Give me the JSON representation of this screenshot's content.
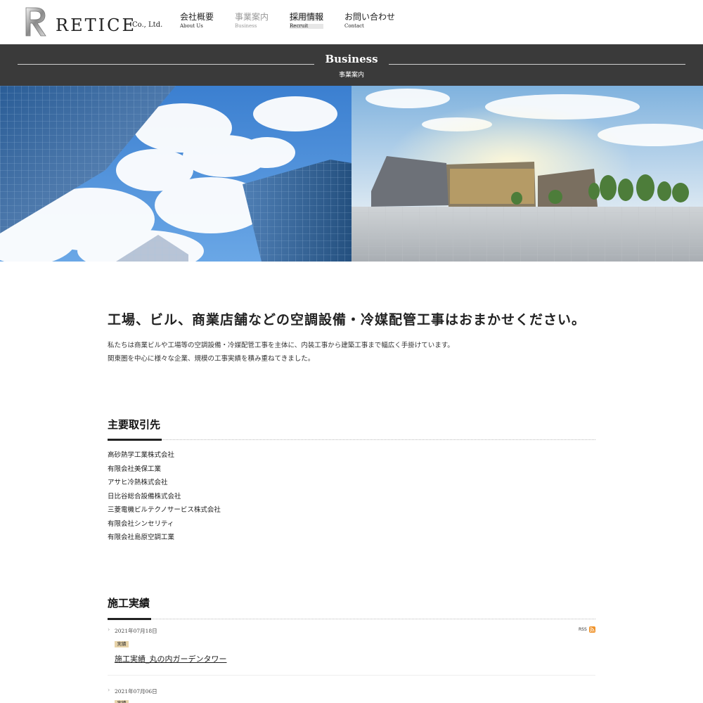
{
  "header": {
    "logo_text": "RETICE",
    "logo_sub": "Co., Ltd.",
    "nav": [
      {
        "jp": "会社概要",
        "en": "About Us"
      },
      {
        "jp": "事業案内",
        "en": "Business"
      },
      {
        "jp": "採用情報",
        "en": "Recruit"
      },
      {
        "jp": "お問い合わせ",
        "en": "Contact"
      }
    ]
  },
  "banner": {
    "title": "Business",
    "subtitle": "事業案内"
  },
  "intro": {
    "lead": "工場、ビル、商業店舗などの空調設備・冷媒配管工事はおまかせください。",
    "line1": "私たちは商業ビルや工場等の空調設備・冷媒配管工事を主体に、内装工事から建築工事まで幅広く手掛けています。",
    "line2": "関東圏を中心に様々な企業、規模の工事実績を積み重ねてきました。"
  },
  "clients": {
    "title": "主要取引先",
    "items": [
      "高砂熱学工業株式会社",
      "有限会社美保工業",
      "アサヒ冷熱株式会社",
      "日比谷総合設備株式会社",
      "三菱電機ビルテクノサービス株式会社",
      "有限会社シンセリティ",
      "有限会社島原空調工業"
    ]
  },
  "works": {
    "title": "施工実績",
    "rss_label": "RSS",
    "posts": [
      {
        "date": "2021年07月18日",
        "tag": "実績",
        "title": "施工実績_丸の内ガーデンタワー"
      },
      {
        "date": "2021年07月06日",
        "tag": "実績",
        "title": ""
      }
    ]
  },
  "colors": {
    "band": "#3a3a3a",
    "tag": "#e7d3a9",
    "rss": "#f0932b"
  }
}
